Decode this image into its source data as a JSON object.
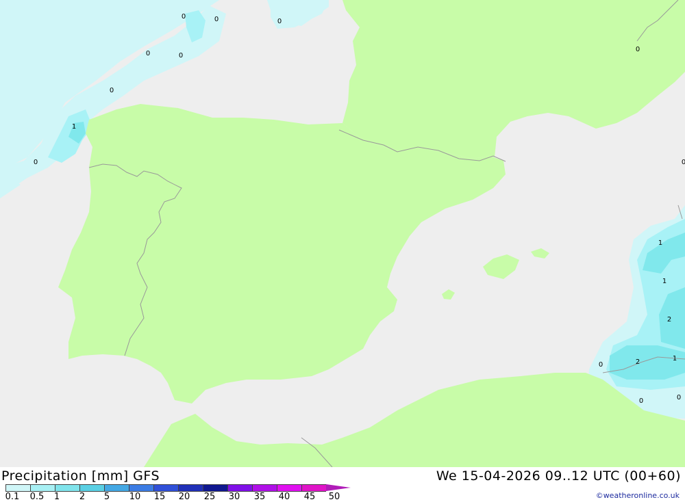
{
  "map": {
    "sea_color": "#eeeeee",
    "land_color": "#c8fca8",
    "border_color": "#999999",
    "precip_colors": [
      "#d0f6f8",
      "#a8f2f6",
      "#80e8ec"
    ],
    "contour_labels": [
      "0",
      "0",
      "0",
      "0",
      "0",
      "0",
      "1",
      "0",
      "0",
      "0",
      "1",
      "1",
      "2",
      "0",
      "2",
      "1",
      "0",
      "0"
    ]
  },
  "footer": {
    "title": "Precipitation [mm] GFS",
    "valid_time": "We 15-04-2026 09..12 UTC (00+60)",
    "credit": "©weatheronline.co.uk"
  },
  "legend": {
    "labels": [
      "0.1",
      "0.5",
      "1",
      "2",
      "5",
      "10",
      "15",
      "20",
      "25",
      "30",
      "35",
      "40",
      "45",
      "50"
    ],
    "colors": [
      "#d0f6f8",
      "#a8f0f4",
      "#80e4ec",
      "#5ad0e4",
      "#44a8e4",
      "#3c7ce4",
      "#3050d8",
      "#2030b8",
      "#101890",
      "#8010e8",
      "#b010e8",
      "#e010f0",
      "#e014c8",
      "#b01cb8"
    ]
  }
}
